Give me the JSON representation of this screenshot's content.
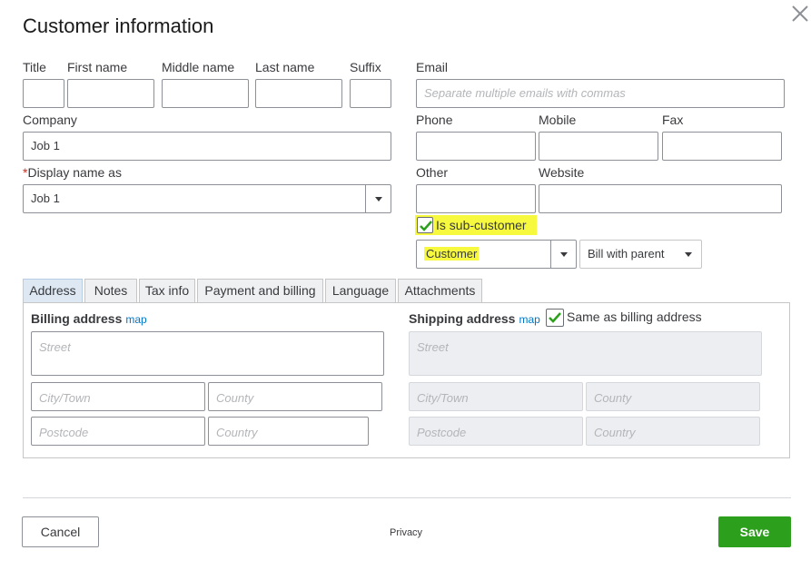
{
  "dialog": {
    "title": "Customer information"
  },
  "name": {
    "title_label": "Title",
    "first_label": "First name",
    "middle_label": "Middle name",
    "last_label": "Last name",
    "suffix_label": "Suffix"
  },
  "email": {
    "label": "Email",
    "placeholder": "Separate multiple emails with commas"
  },
  "company": {
    "label": "Company",
    "value": "Job 1"
  },
  "display_name": {
    "required_mark": "*",
    "label": "Display name as",
    "value": "Job 1"
  },
  "phone": {
    "label": "Phone"
  },
  "mobile": {
    "label": "Mobile"
  },
  "fax": {
    "label": "Fax"
  },
  "other": {
    "label": "Other"
  },
  "website": {
    "label": "Website"
  },
  "sub_customer": {
    "label": "Is sub-customer",
    "checked": true,
    "parent_value": "Customer",
    "billing_value": "Bill with parent"
  },
  "tabs": [
    "Address",
    "Notes",
    "Tax info",
    "Payment and billing",
    "Language",
    "Attachments"
  ],
  "billing": {
    "label": "Billing address",
    "map": "map",
    "street": "Street",
    "city": "City/Town",
    "county": "County",
    "postcode": "Postcode",
    "country": "Country"
  },
  "shipping": {
    "label": "Shipping address",
    "map": "map",
    "same_label": "Same as billing address",
    "same_checked": true,
    "street": "Street",
    "city": "City/Town",
    "county": "County",
    "postcode": "Postcode",
    "country": "Country"
  },
  "footer": {
    "cancel": "Cancel",
    "privacy": "Privacy",
    "save": "Save"
  },
  "colors": {
    "accent_green": "#2ca01c",
    "link_blue": "#0077c5",
    "highlight": "#f6f93e"
  }
}
